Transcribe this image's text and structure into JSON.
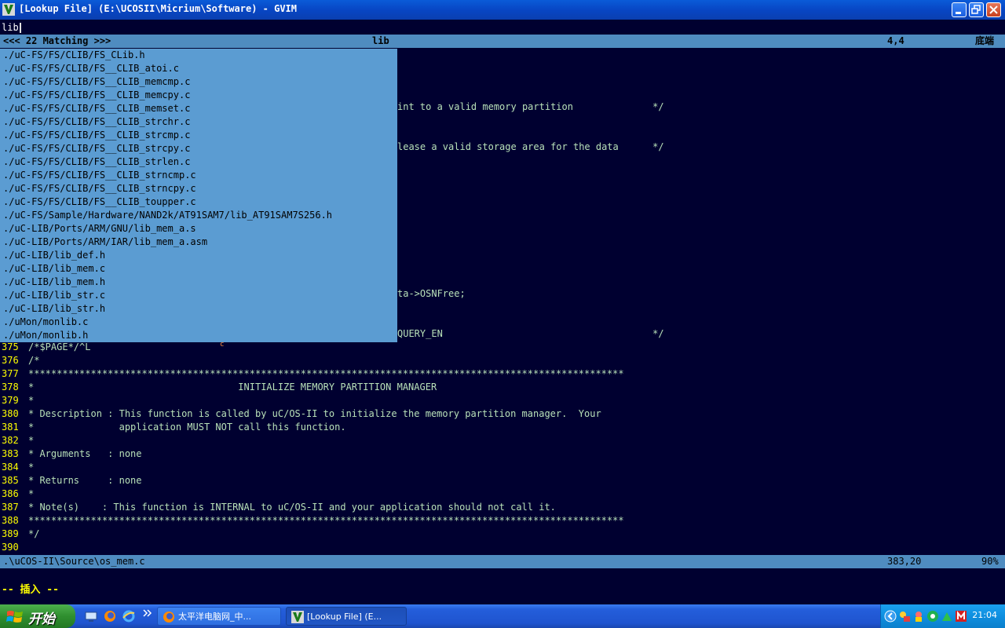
{
  "window": {
    "title": "[Lookup File] (E:\\UCOSII\\Micrium\\Software) - GVIM"
  },
  "lookup": {
    "cmdline": "lib",
    "status_left": "<<< 22 Matching >>>",
    "status_mid": "lib",
    "status_pos": "4,4",
    "status_pct": "底端",
    "results": [
      "./uC-FS/FS/CLIB/FS_CLib.h",
      "./uC-FS/FS/CLIB/FS__CLIB_atoi.c",
      "./uC-FS/FS/CLIB/FS__CLIB_memcmp.c",
      "./uC-FS/FS/CLIB/FS__CLIB_memcpy.c",
      "./uC-FS/FS/CLIB/FS__CLIB_memset.c",
      "./uC-FS/FS/CLIB/FS__CLIB_strchr.c",
      "./uC-FS/FS/CLIB/FS__CLIB_strcmp.c",
      "./uC-FS/FS/CLIB/FS__CLIB_strcpy.c",
      "./uC-FS/FS/CLIB/FS__CLIB_strlen.c",
      "./uC-FS/FS/CLIB/FS__CLIB_strncmp.c",
      "./uC-FS/FS/CLIB/FS__CLIB_strncpy.c",
      "./uC-FS/FS/CLIB/FS__CLIB_toupper.c",
      "./uC-FS/Sample/Hardware/NAND2k/AT91SAM7/lib_AT91SAM7S256.h",
      "./uC-LIB/Ports/ARM/GNU/lib_mem_a.s",
      "./uC-LIB/Ports/ARM/IAR/lib_mem_a.asm",
      "./uC-LIB/lib_def.h",
      "./uC-LIB/lib_mem.c",
      "./uC-LIB/lib_mem.h",
      "./uC-LIB/lib_str.c",
      "./uC-LIB/lib_str.h",
      "./uMon/monlib.c",
      "./uMon/monlib.h"
    ]
  },
  "background_fragments": [
    "int to a valid memory partition              */",
    "lease a valid storage area for the data      */",
    "ta->OSNFree;",
    "QUERY_EN                                     */"
  ],
  "code_lines": [
    {
      "num": "375",
      "text": "/*$PAGE*/^L",
      "mark": "c"
    },
    {
      "num": "376",
      "text": "/*"
    },
    {
      "num": "377",
      "text": "*********************************************************************************************************"
    },
    {
      "num": "378",
      "text": "*                                    INITIALIZE MEMORY PARTITION MANAGER"
    },
    {
      "num": "379",
      "text": "*"
    },
    {
      "num": "380",
      "text": "* Description : This function is called by uC/OS-II to initialize the memory partition manager.  Your"
    },
    {
      "num": "381",
      "text": "*               application MUST NOT call this function."
    },
    {
      "num": "382",
      "text": "*"
    },
    {
      "num": "383",
      "text": "* Arguments   : none"
    },
    {
      "num": "384",
      "text": "*"
    },
    {
      "num": "385",
      "text": "* Returns     : none"
    },
    {
      "num": "386",
      "text": "*"
    },
    {
      "num": "387",
      "text": "* Note(s)    : This function is INTERNAL to uC/OS-II and your application should not call it."
    },
    {
      "num": "388",
      "text": "*********************************************************************************************************"
    },
    {
      "num": "389",
      "text": "*/"
    },
    {
      "num": "390",
      "text": ""
    }
  ],
  "statusline": {
    "file": ".\\uCOS-II\\Source\\os_mem.c",
    "pos": "383,20",
    "pct": "90%"
  },
  "mode": "-- 插入 --",
  "taskbar": {
    "start_label": "开始",
    "tasks": [
      {
        "label": "太平洋电脑网_中..."
      },
      {
        "label": "[Lookup File] (E..."
      }
    ],
    "clock": "21:04"
  },
  "colors": {
    "vim_bg": "#000030",
    "linenr": "#ffff00",
    "comment": "#b8e0b8",
    "popup_bg": "#5b9cd2",
    "status_bg": "#4f8cc0"
  }
}
